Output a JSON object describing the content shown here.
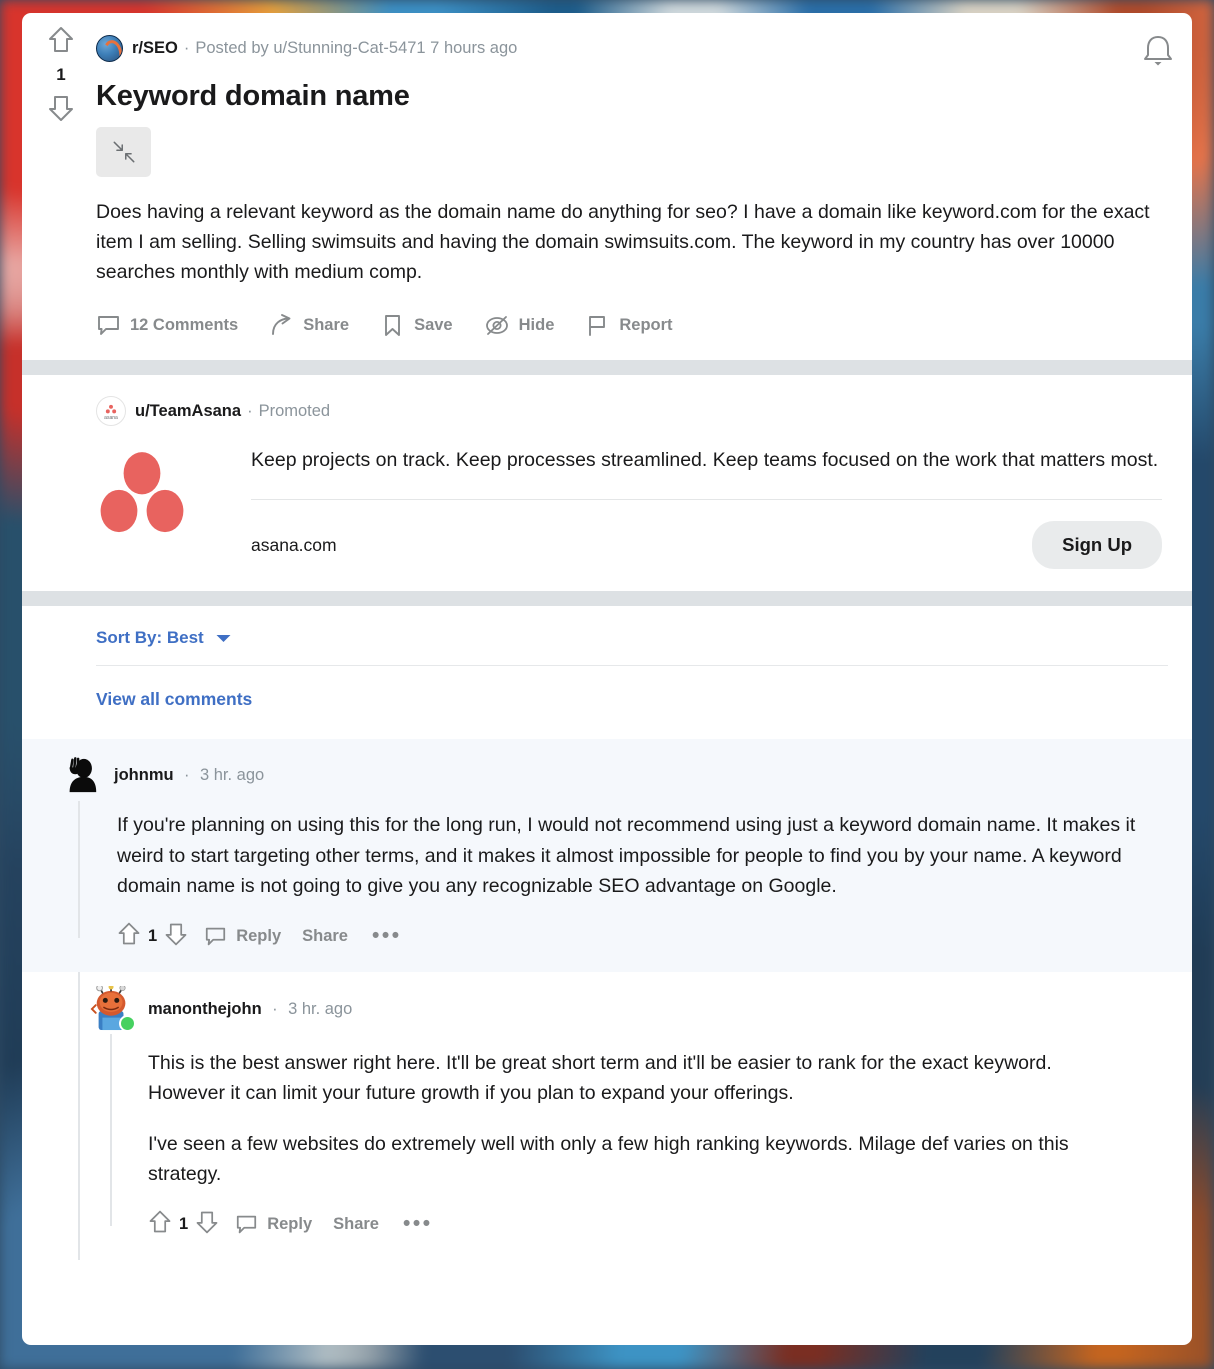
{
  "post": {
    "vote": {
      "score": "1",
      "upvote_icon": "upvote-arrow-icon",
      "downvote_icon": "downvote-arrow-icon"
    },
    "subreddit": "r/SEO",
    "separator": "·",
    "meta": "Posted by u/Stunning-Cat-5471 7 hours ago",
    "title": "Keyword domain name",
    "collapse_icon": "collapse-arrows-icon",
    "body": "Does having a relevant keyword as the domain name do anything for seo? I have a domain like keyword.com for the exact item I am selling. Selling swimsuits and having the domain swimsuits.com. The keyword in my country has over 10000 searches monthly with medium comp.",
    "actions": [
      {
        "label": "12 Comments",
        "icon": "comment-bubble-icon"
      },
      {
        "label": "Share",
        "icon": "share-arrow-icon"
      },
      {
        "label": "Save",
        "icon": "bookmark-icon"
      },
      {
        "label": "Hide",
        "icon": "eye-slash-icon"
      },
      {
        "label": "Report",
        "icon": "flag-icon"
      }
    ]
  },
  "notification_icon": "bell-icon",
  "ad": {
    "user": "u/TeamAsana",
    "separator": "·",
    "promoted": "Promoted",
    "logo_icon": "asana-logo-icon",
    "art_icon": "asana-three-dots-icon",
    "text": "Keep projects on track. Keep processes streamlined. Keep teams focused on the work that matters most.",
    "domain": "asana.com",
    "cta": "Sign Up",
    "accent_color": "#e8635f"
  },
  "sort": {
    "label": "Sort By: Best",
    "chevron_icon": "chevron-down-icon",
    "view_all": "View all comments",
    "link_color": "#3f6fc4"
  },
  "comments": [
    {
      "avatar_icon": "johnmu-silhouette-avatar",
      "user": "johnmu",
      "separator": "·",
      "time": "3 hr. ago",
      "body": [
        "If you're planning on using this for the long run, I would not recommend using just a keyword domain name. It makes it weird to start targeting other terms, and it makes it almost impossible for people to find you by your name. A keyword domain name is not going to give you any recognizable SEO advantage on Google."
      ],
      "score": "1",
      "reply_label": "Reply",
      "share_label": "Share",
      "more_label": "•••"
    },
    {
      "avatar_icon": "manonthejohn-snoo-avatar",
      "user": "manonthejohn",
      "separator": "·",
      "time": "3 hr. ago",
      "body": [
        "This is the best answer right here. It'll be great short term and it'll be easier to rank for the exact keyword. However it can limit your future growth if you plan to expand your offerings.",
        "I've seen a few websites do extremely well with only a few high ranking keywords. Milage def varies on this strategy."
      ],
      "score": "1",
      "reply_label": "Reply",
      "share_label": "Share",
      "more_label": "•••",
      "online": true
    }
  ]
}
